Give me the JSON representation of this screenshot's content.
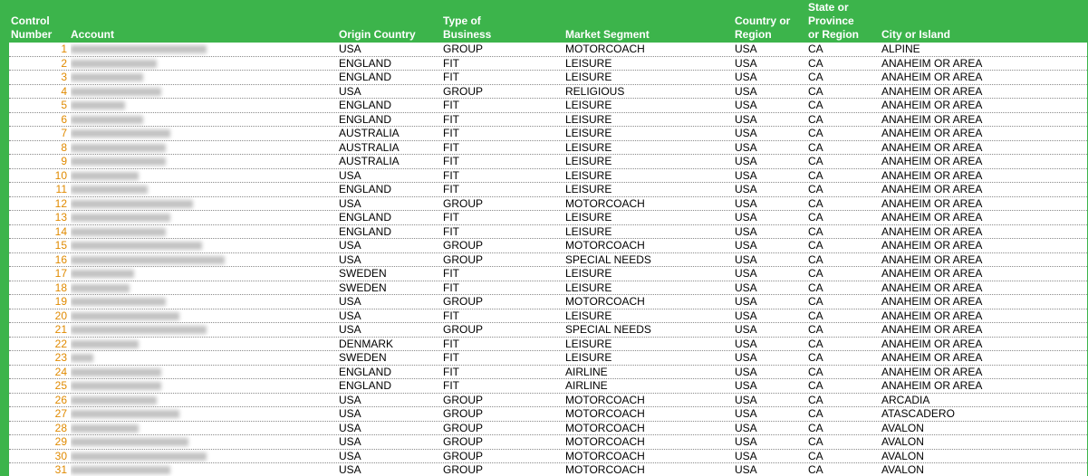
{
  "headers": {
    "control_number": "Control\nNumber",
    "account": "Account",
    "origin_country": "Origin Country",
    "type_of_business": "Type of\nBusiness",
    "market_segment": "Market Segment",
    "country_or_region": "Country or\nRegion",
    "state_or_province": "State or\nProvince\nor Region",
    "city_or_island": "City or Island"
  },
  "rows": [
    {
      "n": "1",
      "o": "USA",
      "t": "GROUP",
      "m": "MOTORCOACH",
      "c": "USA",
      "s": "CA",
      "city": "ALPINE"
    },
    {
      "n": "2",
      "o": "ENGLAND",
      "t": "FIT",
      "m": "LEISURE",
      "c": "USA",
      "s": "CA",
      "city": "ANAHEIM OR AREA"
    },
    {
      "n": "3",
      "o": "ENGLAND",
      "t": "FIT",
      "m": "LEISURE",
      "c": "USA",
      "s": "CA",
      "city": "ANAHEIM OR AREA"
    },
    {
      "n": "4",
      "o": "USA",
      "t": "GROUP",
      "m": "RELIGIOUS",
      "c": "USA",
      "s": "CA",
      "city": "ANAHEIM OR AREA"
    },
    {
      "n": "5",
      "o": "ENGLAND",
      "t": "FIT",
      "m": "LEISURE",
      "c": "USA",
      "s": "CA",
      "city": "ANAHEIM OR AREA"
    },
    {
      "n": "6",
      "o": "ENGLAND",
      "t": "FIT",
      "m": "LEISURE",
      "c": "USA",
      "s": "CA",
      "city": "ANAHEIM OR AREA"
    },
    {
      "n": "7",
      "o": "AUSTRALIA",
      "t": "FIT",
      "m": "LEISURE",
      "c": "USA",
      "s": "CA",
      "city": "ANAHEIM OR AREA"
    },
    {
      "n": "8",
      "o": "AUSTRALIA",
      "t": "FIT",
      "m": "LEISURE",
      "c": "USA",
      "s": "CA",
      "city": "ANAHEIM OR AREA"
    },
    {
      "n": "9",
      "o": "AUSTRALIA",
      "t": "FIT",
      "m": "LEISURE",
      "c": "USA",
      "s": "CA",
      "city": "ANAHEIM OR AREA"
    },
    {
      "n": "10",
      "o": "USA",
      "t": "FIT",
      "m": "LEISURE",
      "c": "USA",
      "s": "CA",
      "city": "ANAHEIM OR AREA"
    },
    {
      "n": "11",
      "o": "ENGLAND",
      "t": "FIT",
      "m": "LEISURE",
      "c": "USA",
      "s": "CA",
      "city": "ANAHEIM OR AREA"
    },
    {
      "n": "12",
      "o": "USA",
      "t": "GROUP",
      "m": "MOTORCOACH",
      "c": "USA",
      "s": "CA",
      "city": "ANAHEIM OR AREA"
    },
    {
      "n": "13",
      "o": "ENGLAND",
      "t": "FIT",
      "m": "LEISURE",
      "c": "USA",
      "s": "CA",
      "city": "ANAHEIM OR AREA"
    },
    {
      "n": "14",
      "o": "ENGLAND",
      "t": "FIT",
      "m": "LEISURE",
      "c": "USA",
      "s": "CA",
      "city": "ANAHEIM OR AREA"
    },
    {
      "n": "15",
      "o": "USA",
      "t": "GROUP",
      "m": "MOTORCOACH",
      "c": "USA",
      "s": "CA",
      "city": "ANAHEIM OR AREA"
    },
    {
      "n": "16",
      "o": "USA",
      "t": "GROUP",
      "m": "SPECIAL NEEDS",
      "c": "USA",
      "s": "CA",
      "city": "ANAHEIM OR AREA"
    },
    {
      "n": "17",
      "o": "SWEDEN",
      "t": "FIT",
      "m": "LEISURE",
      "c": "USA",
      "s": "CA",
      "city": "ANAHEIM OR AREA"
    },
    {
      "n": "18",
      "o": "SWEDEN",
      "t": "FIT",
      "m": "LEISURE",
      "c": "USA",
      "s": "CA",
      "city": "ANAHEIM OR AREA"
    },
    {
      "n": "19",
      "o": "USA",
      "t": "GROUP",
      "m": "MOTORCOACH",
      "c": "USA",
      "s": "CA",
      "city": "ANAHEIM OR AREA"
    },
    {
      "n": "20",
      "o": "USA",
      "t": "FIT",
      "m": "LEISURE",
      "c": "USA",
      "s": "CA",
      "city": "ANAHEIM OR AREA"
    },
    {
      "n": "21",
      "o": "USA",
      "t": "GROUP",
      "m": "SPECIAL NEEDS",
      "c": "USA",
      "s": "CA",
      "city": "ANAHEIM OR AREA"
    },
    {
      "n": "22",
      "o": "DENMARK",
      "t": "FIT",
      "m": "LEISURE",
      "c": "USA",
      "s": "CA",
      "city": "ANAHEIM OR AREA"
    },
    {
      "n": "23",
      "o": "SWEDEN",
      "t": "FIT",
      "m": "LEISURE",
      "c": "USA",
      "s": "CA",
      "city": "ANAHEIM OR AREA"
    },
    {
      "n": "24",
      "o": "ENGLAND",
      "t": "FIT",
      "m": "AIRLINE",
      "c": "USA",
      "s": "CA",
      "city": "ANAHEIM OR AREA"
    },
    {
      "n": "25",
      "o": "ENGLAND",
      "t": "FIT",
      "m": "AIRLINE",
      "c": "USA",
      "s": "CA",
      "city": "ANAHEIM OR AREA"
    },
    {
      "n": "26",
      "o": "USA",
      "t": "GROUP",
      "m": "MOTORCOACH",
      "c": "USA",
      "s": "CA",
      "city": "ARCADIA"
    },
    {
      "n": "27",
      "o": "USA",
      "t": "GROUP",
      "m": "MOTORCOACH",
      "c": "USA",
      "s": "CA",
      "city": "ATASCADERO"
    },
    {
      "n": "28",
      "o": "USA",
      "t": "GROUP",
      "m": "MOTORCOACH",
      "c": "USA",
      "s": "CA",
      "city": "AVALON"
    },
    {
      "n": "29",
      "o": "USA",
      "t": "GROUP",
      "m": "MOTORCOACH",
      "c": "USA",
      "s": "CA",
      "city": "AVALON"
    },
    {
      "n": "30",
      "o": "USA",
      "t": "GROUP",
      "m": "MOTORCOACH",
      "c": "USA",
      "s": "CA",
      "city": "AVALON"
    },
    {
      "n": "31",
      "o": "USA",
      "t": "GROUP",
      "m": "MOTORCOACH",
      "c": "USA",
      "s": "CA",
      "city": "AVALON"
    }
  ]
}
